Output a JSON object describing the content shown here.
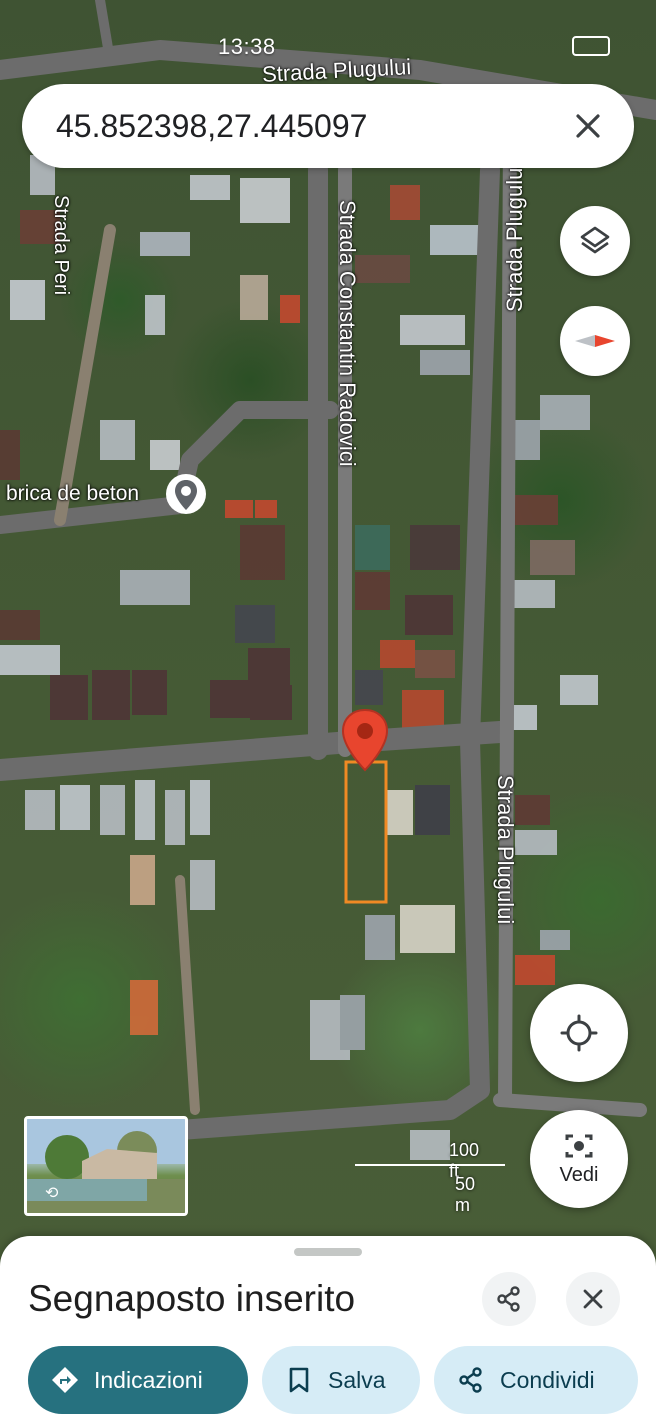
{
  "status_bar": {
    "time": "13:38"
  },
  "search": {
    "query": "45.852398,27.445097"
  },
  "map": {
    "street_labels": {
      "plugului_top": "Strada Plugului",
      "peri": "Strada Peri",
      "constantin_radovici": "Strada Constantin Radovici",
      "plugului_right": "Strada Plugului",
      "plugului_lower": "Strada Plugului"
    },
    "poi_label": "brica de beton",
    "scale": {
      "imperial": "100 ft",
      "metric": "50 m"
    }
  },
  "controls": {
    "vedi_label": "Vedi"
  },
  "bottom_sheet": {
    "title": "Segnaposto inserito",
    "actions": {
      "directions": "Indicazioni",
      "save": "Salva",
      "share": "Condividi"
    }
  },
  "colors": {
    "pin": "#e8452e",
    "primary_chip": "#26717f",
    "secondary_chip": "#d6ecf6",
    "parcel_outline": "#f08a24"
  }
}
